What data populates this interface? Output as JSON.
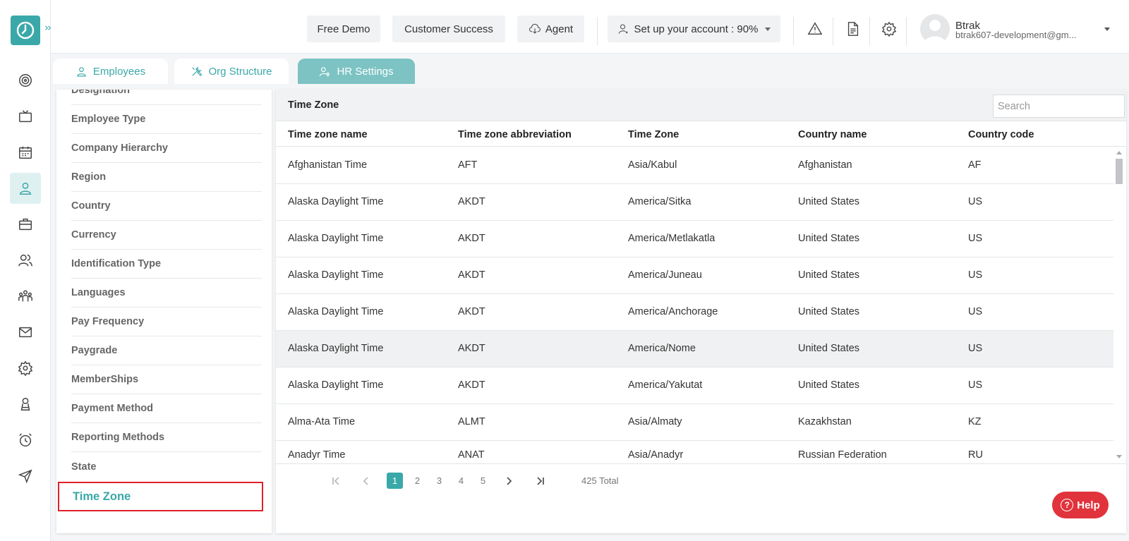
{
  "topbar": {
    "free_demo": "Free Demo",
    "customer_success": "Customer Success",
    "agent": "Agent",
    "setup": "Set up your account : 90%",
    "user_name": "Btrak",
    "user_email": "btrak607-development@gm..."
  },
  "tabs": [
    {
      "label": "Employees",
      "icon": "person-icon"
    },
    {
      "label": "Org Structure",
      "icon": "tools-icon"
    },
    {
      "label": "HR Settings",
      "icon": "user-gear-icon"
    }
  ],
  "settings_list": [
    "Designation",
    "Employee Type",
    "Company Hierarchy",
    "Region",
    "Country",
    "Currency",
    "Identification Type",
    "Languages",
    "Pay Frequency",
    "Paygrade",
    "MemberShips",
    "Payment Method",
    "Reporting Methods",
    "State",
    "Time Zone"
  ],
  "panel": {
    "title": "Time Zone",
    "search_placeholder": "Search",
    "columns": [
      "Time zone name",
      "Time zone abbreviation",
      "Time Zone",
      "Country name",
      "Country code"
    ],
    "rows": [
      [
        "Afghanistan Time",
        "AFT",
        "Asia/Kabul",
        "Afghanistan",
        "AF"
      ],
      [
        "Alaska Daylight Time",
        "AKDT",
        "America/Sitka",
        "United States",
        "US"
      ],
      [
        "Alaska Daylight Time",
        "AKDT",
        "America/Metlakatla",
        "United States",
        "US"
      ],
      [
        "Alaska Daylight Time",
        "AKDT",
        "America/Juneau",
        "United States",
        "US"
      ],
      [
        "Alaska Daylight Time",
        "AKDT",
        "America/Anchorage",
        "United States",
        "US"
      ],
      [
        "Alaska Daylight Time",
        "AKDT",
        "America/Nome",
        "United States",
        "US"
      ],
      [
        "Alaska Daylight Time",
        "AKDT",
        "America/Yakutat",
        "United States",
        "US"
      ],
      [
        "Alma-Ata Time",
        "ALMT",
        "Asia/Almaty",
        "Kazakhstan",
        "KZ"
      ],
      [
        "Anadyr Time",
        "ANAT",
        "Asia/Anadyr",
        "Russian Federation",
        "RU"
      ]
    ],
    "pages": [
      "1",
      "2",
      "3",
      "4",
      "5"
    ],
    "total": "425 Total"
  },
  "help": "Help",
  "colors": {
    "accent": "#3aa8a8",
    "help": "#e1333b",
    "highlight": "#e0202a"
  }
}
